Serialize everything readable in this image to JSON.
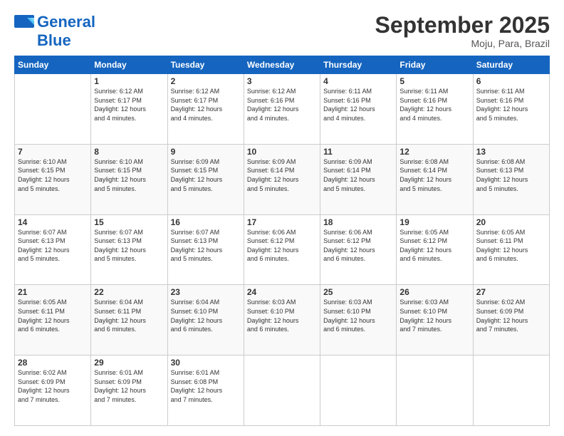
{
  "logo": {
    "line1": "General",
    "line2": "Blue"
  },
  "header": {
    "month": "September 2025",
    "location": "Moju, Para, Brazil"
  },
  "days_of_week": [
    "Sunday",
    "Monday",
    "Tuesday",
    "Wednesday",
    "Thursday",
    "Friday",
    "Saturday"
  ],
  "weeks": [
    [
      {
        "day": "",
        "info": ""
      },
      {
        "day": "1",
        "info": "Sunrise: 6:12 AM\nSunset: 6:17 PM\nDaylight: 12 hours\nand 4 minutes."
      },
      {
        "day": "2",
        "info": "Sunrise: 6:12 AM\nSunset: 6:17 PM\nDaylight: 12 hours\nand 4 minutes."
      },
      {
        "day": "3",
        "info": "Sunrise: 6:12 AM\nSunset: 6:16 PM\nDaylight: 12 hours\nand 4 minutes."
      },
      {
        "day": "4",
        "info": "Sunrise: 6:11 AM\nSunset: 6:16 PM\nDaylight: 12 hours\nand 4 minutes."
      },
      {
        "day": "5",
        "info": "Sunrise: 6:11 AM\nSunset: 6:16 PM\nDaylight: 12 hours\nand 4 minutes."
      },
      {
        "day": "6",
        "info": "Sunrise: 6:11 AM\nSunset: 6:16 PM\nDaylight: 12 hours\nand 5 minutes."
      }
    ],
    [
      {
        "day": "7",
        "info": "Sunrise: 6:10 AM\nSunset: 6:15 PM\nDaylight: 12 hours\nand 5 minutes."
      },
      {
        "day": "8",
        "info": "Sunrise: 6:10 AM\nSunset: 6:15 PM\nDaylight: 12 hours\nand 5 minutes."
      },
      {
        "day": "9",
        "info": "Sunrise: 6:09 AM\nSunset: 6:15 PM\nDaylight: 12 hours\nand 5 minutes."
      },
      {
        "day": "10",
        "info": "Sunrise: 6:09 AM\nSunset: 6:14 PM\nDaylight: 12 hours\nand 5 minutes."
      },
      {
        "day": "11",
        "info": "Sunrise: 6:09 AM\nSunset: 6:14 PM\nDaylight: 12 hours\nand 5 minutes."
      },
      {
        "day": "12",
        "info": "Sunrise: 6:08 AM\nSunset: 6:14 PM\nDaylight: 12 hours\nand 5 minutes."
      },
      {
        "day": "13",
        "info": "Sunrise: 6:08 AM\nSunset: 6:13 PM\nDaylight: 12 hours\nand 5 minutes."
      }
    ],
    [
      {
        "day": "14",
        "info": "Sunrise: 6:07 AM\nSunset: 6:13 PM\nDaylight: 12 hours\nand 5 minutes."
      },
      {
        "day": "15",
        "info": "Sunrise: 6:07 AM\nSunset: 6:13 PM\nDaylight: 12 hours\nand 5 minutes."
      },
      {
        "day": "16",
        "info": "Sunrise: 6:07 AM\nSunset: 6:13 PM\nDaylight: 12 hours\nand 5 minutes."
      },
      {
        "day": "17",
        "info": "Sunrise: 6:06 AM\nSunset: 6:12 PM\nDaylight: 12 hours\nand 6 minutes."
      },
      {
        "day": "18",
        "info": "Sunrise: 6:06 AM\nSunset: 6:12 PM\nDaylight: 12 hours\nand 6 minutes."
      },
      {
        "day": "19",
        "info": "Sunrise: 6:05 AM\nSunset: 6:12 PM\nDaylight: 12 hours\nand 6 minutes."
      },
      {
        "day": "20",
        "info": "Sunrise: 6:05 AM\nSunset: 6:11 PM\nDaylight: 12 hours\nand 6 minutes."
      }
    ],
    [
      {
        "day": "21",
        "info": "Sunrise: 6:05 AM\nSunset: 6:11 PM\nDaylight: 12 hours\nand 6 minutes."
      },
      {
        "day": "22",
        "info": "Sunrise: 6:04 AM\nSunset: 6:11 PM\nDaylight: 12 hours\nand 6 minutes."
      },
      {
        "day": "23",
        "info": "Sunrise: 6:04 AM\nSunset: 6:10 PM\nDaylight: 12 hours\nand 6 minutes."
      },
      {
        "day": "24",
        "info": "Sunrise: 6:03 AM\nSunset: 6:10 PM\nDaylight: 12 hours\nand 6 minutes."
      },
      {
        "day": "25",
        "info": "Sunrise: 6:03 AM\nSunset: 6:10 PM\nDaylight: 12 hours\nand 6 minutes."
      },
      {
        "day": "26",
        "info": "Sunrise: 6:03 AM\nSunset: 6:10 PM\nDaylight: 12 hours\nand 7 minutes."
      },
      {
        "day": "27",
        "info": "Sunrise: 6:02 AM\nSunset: 6:09 PM\nDaylight: 12 hours\nand 7 minutes."
      }
    ],
    [
      {
        "day": "28",
        "info": "Sunrise: 6:02 AM\nSunset: 6:09 PM\nDaylight: 12 hours\nand 7 minutes."
      },
      {
        "day": "29",
        "info": "Sunrise: 6:01 AM\nSunset: 6:09 PM\nDaylight: 12 hours\nand 7 minutes."
      },
      {
        "day": "30",
        "info": "Sunrise: 6:01 AM\nSunset: 6:08 PM\nDaylight: 12 hours\nand 7 minutes."
      },
      {
        "day": "",
        "info": ""
      },
      {
        "day": "",
        "info": ""
      },
      {
        "day": "",
        "info": ""
      },
      {
        "day": "",
        "info": ""
      }
    ]
  ]
}
